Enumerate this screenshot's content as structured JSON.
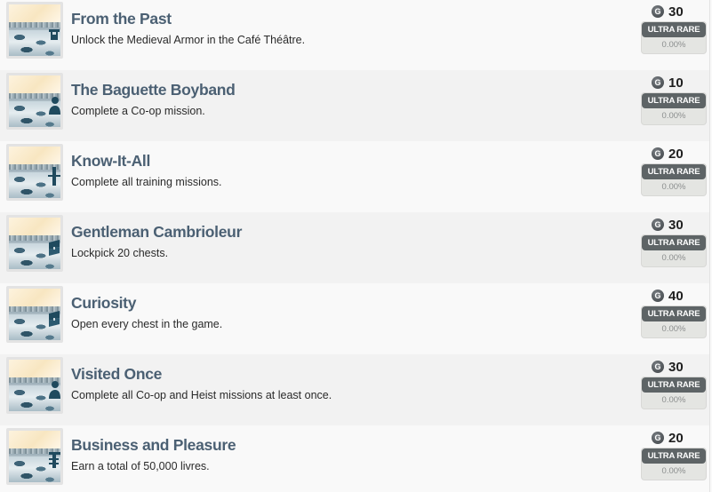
{
  "achievements": [
    {
      "title": "From the Past",
      "description": "Unlock the Medieval Armor in the Café Théâtre.",
      "gamerscore": "30",
      "rarity": "ULTRA RARE",
      "percent": "0.00%",
      "icon": "armor-icon"
    },
    {
      "title": "The Baguette Boyband",
      "description": "Complete a Co-op mission.",
      "gamerscore": "10",
      "rarity": "ULTRA RARE",
      "percent": "0.00%",
      "icon": "person-icon"
    },
    {
      "title": "Know-It-All",
      "description": "Complete all training missions.",
      "gamerscore": "20",
      "rarity": "ULTRA RARE",
      "percent": "0.00%",
      "icon": "post-icon"
    },
    {
      "title": "Gentleman Cambrioleur",
      "description": "Lockpick 20 chests.",
      "gamerscore": "30",
      "rarity": "ULTRA RARE",
      "percent": "0.00%",
      "icon": "chest-icon"
    },
    {
      "title": "Curiosity",
      "description": "Open every chest in the game.",
      "gamerscore": "40",
      "rarity": "ULTRA RARE",
      "percent": "0.00%",
      "icon": "chest-icon"
    },
    {
      "title": "Visited Once",
      "description": "Complete all Co-op and Heist missions at least once.",
      "gamerscore": "30",
      "rarity": "ULTRA RARE",
      "percent": "0.00%",
      "icon": "person-icon"
    },
    {
      "title": "Business and Pleasure",
      "description": "Earn a total of 50,000 livres.",
      "gamerscore": "20",
      "rarity": "ULTRA RARE",
      "percent": "0.00%",
      "icon": "livre-icon"
    }
  ],
  "gamerscore_symbol": "G",
  "colors": {
    "title": "#4b6073",
    "badge": "#5e6466",
    "row_odd": "#f9f9f9",
    "row_even": "#f2f2f2"
  }
}
